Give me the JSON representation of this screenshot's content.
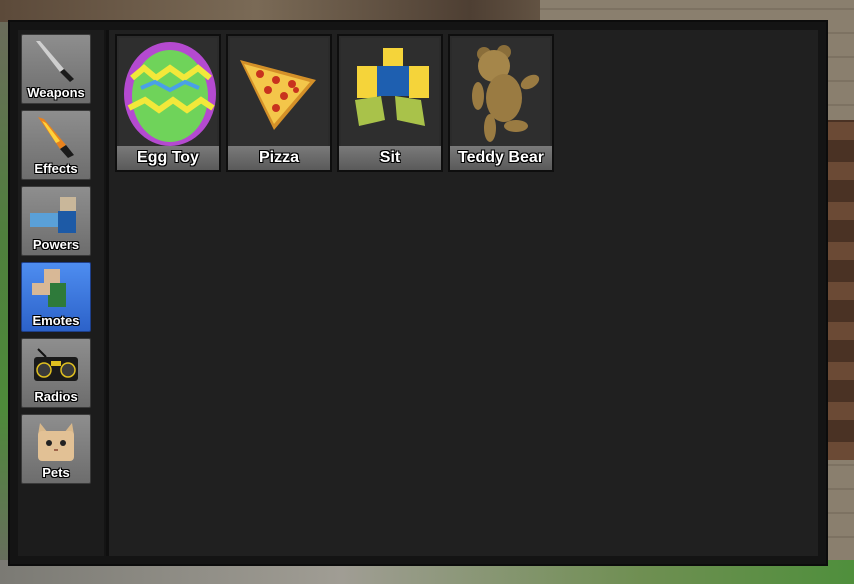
{
  "sidebar": {
    "tabs": [
      {
        "label": "Weapons",
        "icon": "knife-icon"
      },
      {
        "label": "Effects",
        "icon": "flame-knife-icon"
      },
      {
        "label": "Powers",
        "icon": "power-character-icon"
      },
      {
        "label": "Emotes",
        "icon": "emote-character-icon",
        "active": true
      },
      {
        "label": "Radios",
        "icon": "boombox-icon"
      },
      {
        "label": "Pets",
        "icon": "cat-pet-icon"
      }
    ]
  },
  "emotes": {
    "items": [
      {
        "label": "Egg Toy",
        "icon": "easter-egg-icon"
      },
      {
        "label": "Pizza",
        "icon": "pizza-slice-icon"
      },
      {
        "label": "Sit",
        "icon": "sitting-character-icon"
      },
      {
        "label": "Teddy Bear",
        "icon": "teddy-bear-icon"
      }
    ]
  },
  "colors": {
    "active_tab": "#3a78e0",
    "panel": "#202020",
    "tab": "#7d7d7d"
  }
}
